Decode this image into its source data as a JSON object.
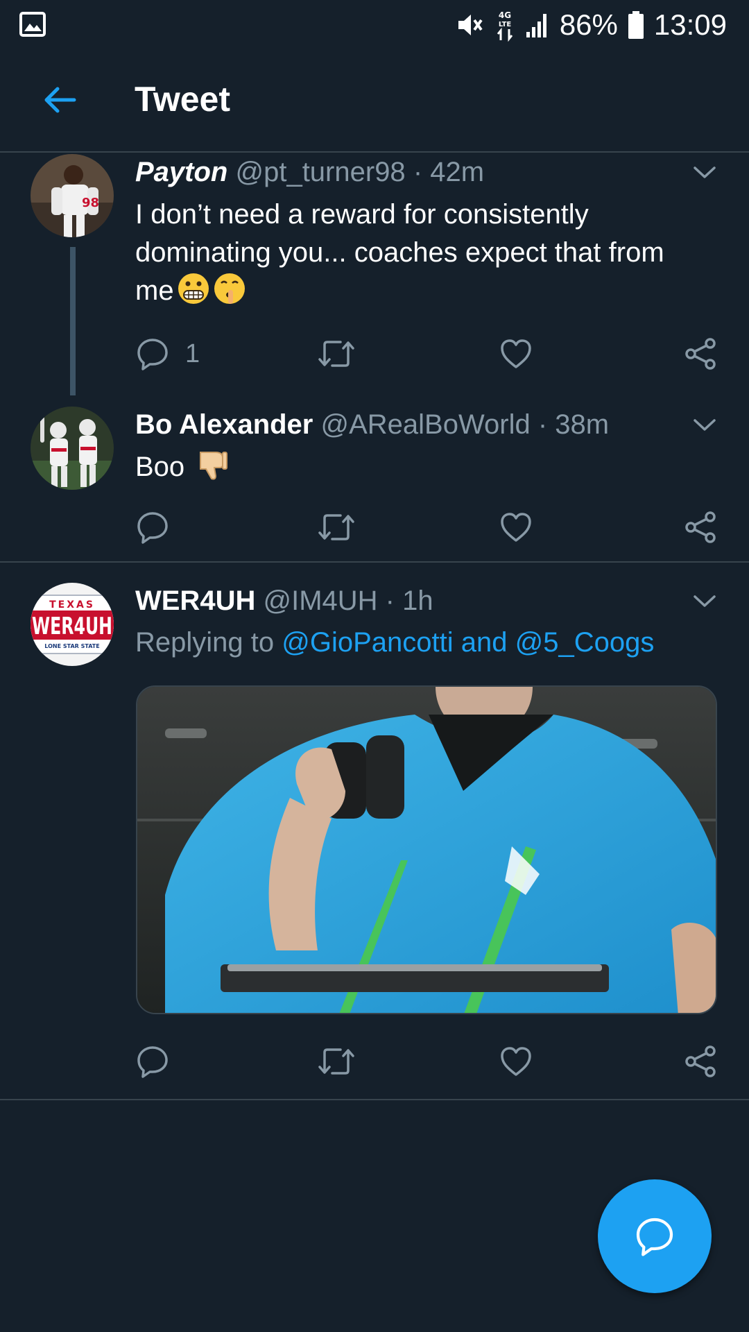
{
  "status_bar": {
    "battery": "86%",
    "time": "13:09",
    "network": "4G LTE",
    "icons": [
      "gallery-notification-icon",
      "mute-icon",
      "data-icon",
      "signal-icon",
      "battery-icon"
    ]
  },
  "header": {
    "title": "Tweet",
    "back_icon": "arrow-left-icon"
  },
  "tweets": [
    {
      "name": "Payton",
      "handle": "@pt_turner98",
      "separator": "·",
      "time": "42m",
      "text": "I don’t need a reward for consistently dominating you... coaches expect that from me",
      "emojis": [
        "grimacing-face",
        "shushing-face"
      ],
      "reply_count": "1"
    },
    {
      "name": "Bo Alexander",
      "handle": "@ARealBoWorld",
      "separator": "·",
      "time": "38m",
      "text": "Boo",
      "emojis": [
        "thumbs-down"
      ]
    },
    {
      "name": "WER4UH",
      "handle": "@IM4UH",
      "separator": "·",
      "time": "1h",
      "replying_prefix": "Replying to",
      "replying_to": "@GioPancotti and @5_Coogs",
      "avatar_plate": {
        "top": "TEXAS",
        "main": "WER4UH",
        "bottom": "LONE STAR STATE"
      }
    }
  ],
  "colors": {
    "background": "#15202b",
    "accent": "#1da1f2",
    "muted_text": "#8899a6",
    "divider": "#38444d"
  },
  "fab": {
    "icon": "compose-reply-icon"
  }
}
